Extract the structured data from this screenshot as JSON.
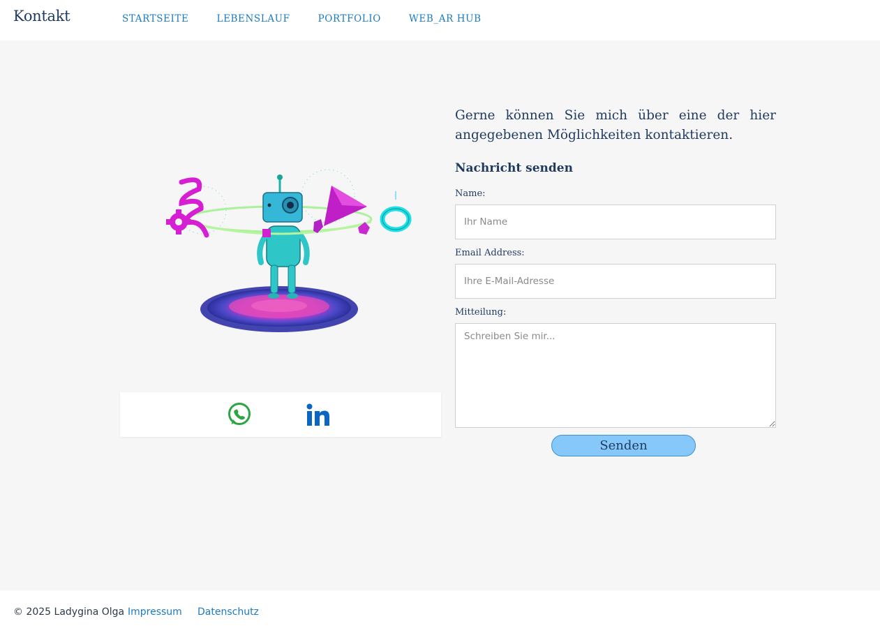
{
  "header": {
    "brand": "Kontakt",
    "nav": [
      "STARTSEITE",
      "LEBENSLAUF",
      "PORTFOLIO",
      "WEB_AR HUB"
    ]
  },
  "intro": "Gerne können Sie mich über eine der hier angegebenen Möglichkeiten kontaktieren.",
  "form": {
    "title": "Nachricht senden",
    "name_label": "Name:",
    "name_placeholder": "Ihr Name",
    "email_label": "Email Address:",
    "email_placeholder": "Ihre E-Mail-Adresse",
    "message_label": "Mitteilung:",
    "message_placeholder": "Schreiben Sie mir...",
    "submit": "Senden"
  },
  "social": {
    "icons": [
      "whatsapp-icon",
      "linkedin-icon"
    ]
  },
  "footer": {
    "copyright": "© 2025 Ladygina Olga",
    "links": [
      "Impressum",
      "Datenschutz"
    ]
  },
  "colors": {
    "accent": "#1a7bc4",
    "text": "#1f3a5f",
    "button": "#87c8fa",
    "whatsapp": "#2ca543",
    "linkedin": "#0a66c2"
  }
}
